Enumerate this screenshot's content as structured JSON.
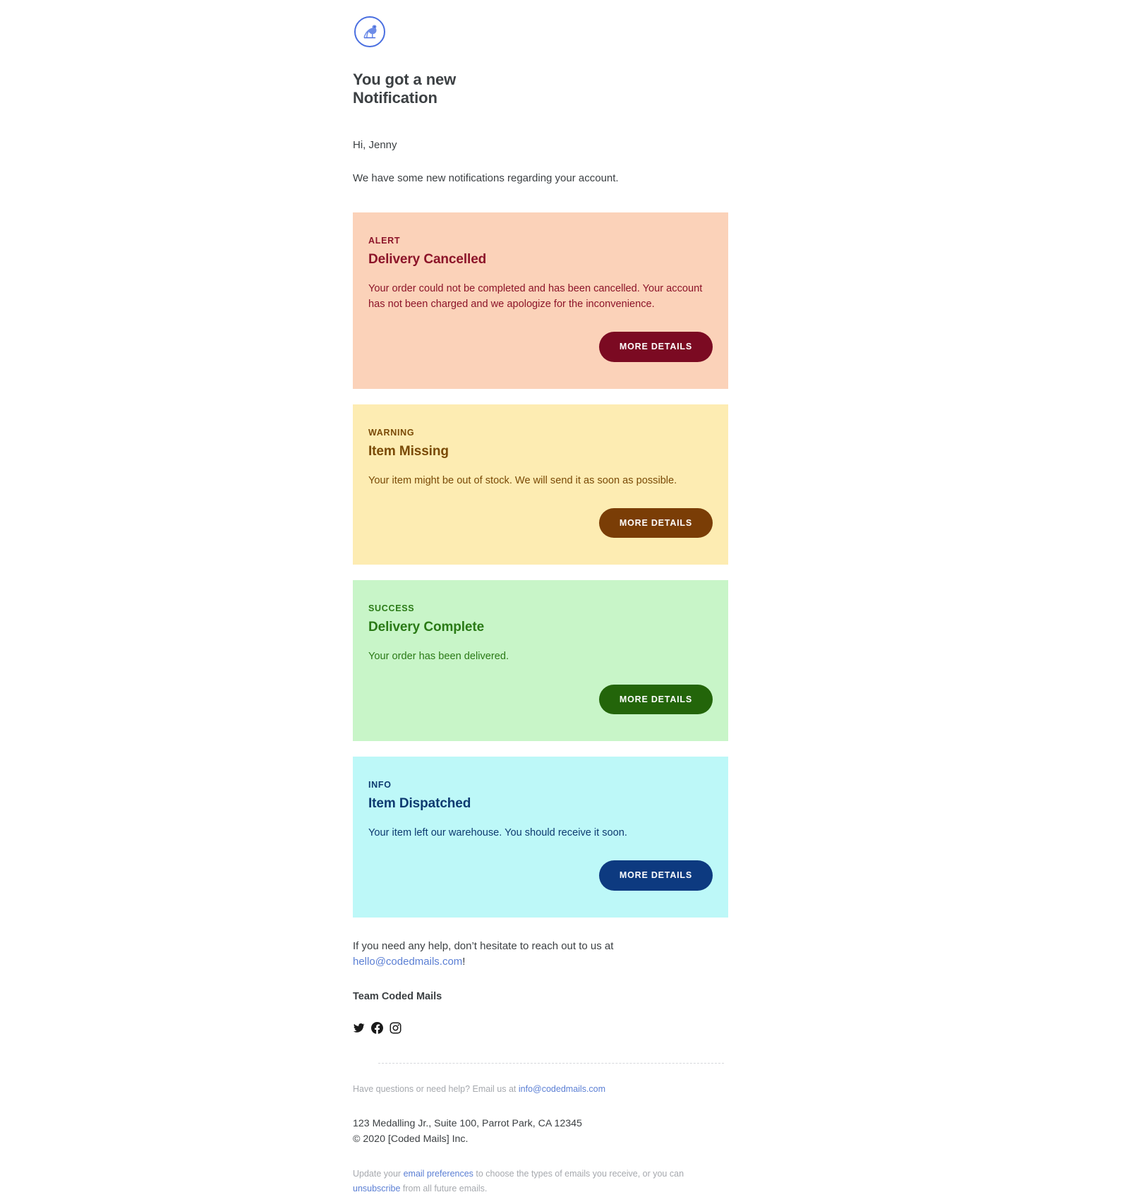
{
  "brand": {
    "logo_icon": "bird-in-circle-logo",
    "logo_color": "#4a6fe0"
  },
  "header": {
    "headline": "You got a new Notification"
  },
  "intro": {
    "greeting": "Hi, Jenny",
    "message": "We have some new notifications regarding your account."
  },
  "cards": [
    {
      "type": "alert",
      "eyebrow": "ALERT",
      "title": "Delivery Cancelled",
      "text": "Your order could not be completed and has been cancelled. Your account has not been charged and we apologize for the inconvenience.",
      "button_label": "MORE DETAILS",
      "bg_color": "#fbd2b9",
      "text_color": "#8c1429",
      "button_color": "#7b0a22"
    },
    {
      "type": "warning",
      "eyebrow": "WARNING",
      "title": "Item Missing",
      "text": "Your item might be out of stock. We will send it as soon as possible.",
      "button_label": "MORE DETAILS",
      "bg_color": "#fdecb2",
      "text_color": "#7a4a06",
      "button_color": "#7a3d06"
    },
    {
      "type": "success",
      "eyebrow": "SUCCESS",
      "title": "Delivery Complete",
      "text": "Your order has been delivered.",
      "button_label": "MORE DETAILS",
      "bg_color": "#c8f5c8",
      "text_color": "#2a7a16",
      "button_color": "#23650a"
    },
    {
      "type": "info",
      "eyebrow": "INFO",
      "title": "Item Dispatched",
      "text": "Your item left our warehouse. You should receive it soon.",
      "button_label": "MORE DETAILS",
      "bg_color": "#bdf8f8",
      "text_color": "#0d3a70",
      "button_color": "#0d3a80"
    }
  ],
  "help": {
    "lead": "If you need any help, don’t hesitate to reach out to us at ",
    "email": "hello@codedmails.com",
    "trailing": "!",
    "signature": "Team Coded Mails"
  },
  "social": [
    {
      "name": "twitter-icon",
      "label": "Twitter"
    },
    {
      "name": "facebook-icon",
      "label": "Facebook"
    },
    {
      "name": "instagram-icon",
      "label": "Instagram"
    }
  ],
  "footer": {
    "questions_lead": "Have questions or need help? Email us at ",
    "questions_email": "info@codedmails.com",
    "address": "123 Medalling Jr., Suite 100, Parrot Park, CA 12345",
    "copyright": "© 2020 [Coded Mails] Inc.",
    "prefs_lead": "Update your ",
    "prefs_link": "email preferences",
    "prefs_mid": " to choose the types of emails you receive, or you can ",
    "unsub_link": "unsubscribe",
    "prefs_tail": " from all future emails."
  }
}
